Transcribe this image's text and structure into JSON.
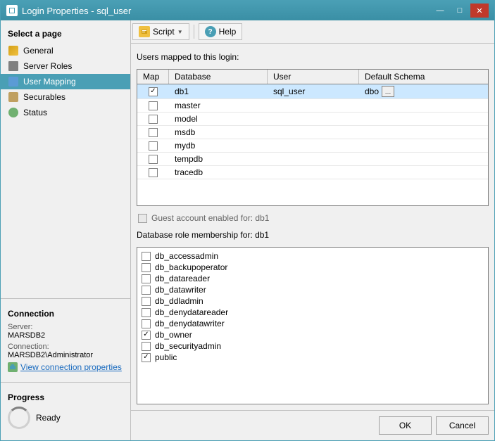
{
  "window": {
    "title": "Login Properties - sql_user",
    "icon": "properties-icon"
  },
  "title_buttons": {
    "minimize": "—",
    "maximize": "□",
    "close": "✕"
  },
  "sidebar": {
    "section_title": "Select a page",
    "items": [
      {
        "id": "general",
        "label": "General",
        "icon": "general-icon",
        "active": false
      },
      {
        "id": "server-roles",
        "label": "Server Roles",
        "icon": "server-roles-icon",
        "active": false
      },
      {
        "id": "user-mapping",
        "label": "User Mapping",
        "icon": "user-mapping-icon",
        "active": true
      },
      {
        "id": "securables",
        "label": "Securables",
        "icon": "securables-icon",
        "active": false
      },
      {
        "id": "status",
        "label": "Status",
        "icon": "status-icon",
        "active": false
      }
    ]
  },
  "connection": {
    "section_title": "Connection",
    "server_label": "Server:",
    "server_value": "MARSDB2",
    "connection_label": "Connection:",
    "connection_value": "MARSDB2\\Administrator",
    "view_link": "View connection properties"
  },
  "progress": {
    "section_title": "Progress",
    "status": "Ready"
  },
  "toolbar": {
    "script_label": "Script",
    "script_dropdown": true,
    "help_label": "Help"
  },
  "main": {
    "users_section_label": "Users mapped to this login:",
    "table_headers": {
      "map": "Map",
      "database": "Database",
      "user": "User",
      "default_schema": "Default Schema"
    },
    "table_rows": [
      {
        "checked": true,
        "database": "db1",
        "user": "sql_user",
        "schema": "dbo",
        "selected": true
      },
      {
        "checked": false,
        "database": "master",
        "user": "",
        "schema": "",
        "selected": false
      },
      {
        "checked": false,
        "database": "model",
        "user": "",
        "schema": "",
        "selected": false
      },
      {
        "checked": false,
        "database": "msdb",
        "user": "",
        "schema": "",
        "selected": false
      },
      {
        "checked": false,
        "database": "mydb",
        "user": "",
        "schema": "",
        "selected": false
      },
      {
        "checked": false,
        "database": "tempdb",
        "user": "",
        "schema": "",
        "selected": false
      },
      {
        "checked": false,
        "database": "tracedb",
        "user": "",
        "schema": "",
        "selected": false
      }
    ],
    "guest_label": "Guest account enabled for: db1",
    "roles_section_label": "Database role membership for: db1",
    "roles": [
      {
        "checked": false,
        "label": "db_accessadmin"
      },
      {
        "checked": false,
        "label": "db_backupoperator"
      },
      {
        "checked": false,
        "label": "db_datareader"
      },
      {
        "checked": false,
        "label": "db_datawriter"
      },
      {
        "checked": false,
        "label": "db_ddladmin"
      },
      {
        "checked": false,
        "label": "db_denydatareader"
      },
      {
        "checked": false,
        "label": "db_denydatawriter"
      },
      {
        "checked": true,
        "label": "db_owner"
      },
      {
        "checked": false,
        "label": "db_securityadmin"
      },
      {
        "checked": true,
        "label": "public"
      }
    ]
  },
  "footer": {
    "ok_label": "OK",
    "cancel_label": "Cancel"
  }
}
